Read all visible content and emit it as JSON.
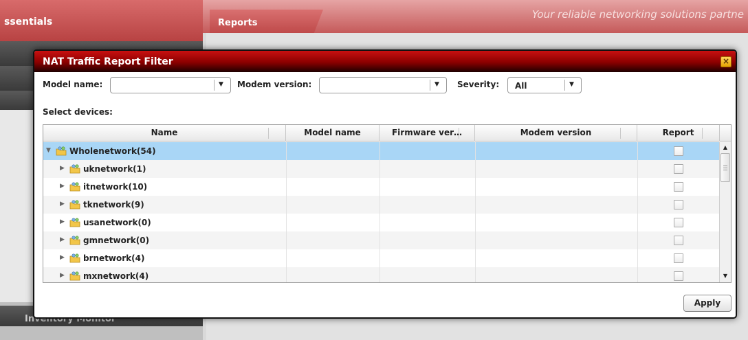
{
  "background": {
    "left_header": "ssentials",
    "tab": "Reports",
    "slogan": "Your reliable networking solutions partne",
    "bottom_item": "Inventory Monitor"
  },
  "dialog": {
    "title": "NAT Traffic Report Filter",
    "close_icon": "close-icon",
    "filters": {
      "model_name_label": "Model name:",
      "model_name_value": "",
      "modem_version_label": "Modem version:",
      "modem_version_value": "",
      "severity_label": "Severity:",
      "severity_value": "All"
    },
    "select_devices_label": "Select devices:",
    "columns": [
      "Name",
      "Model name",
      "Firmware ver…",
      "Modem version",
      "Report"
    ],
    "rows": [
      {
        "name": "Wholenetwork(54)",
        "expanded": true,
        "selected": true,
        "report": false
      },
      {
        "name": "uknetwork(1)",
        "expanded": false,
        "report": false
      },
      {
        "name": "itnetwork(10)",
        "expanded": false,
        "report": false
      },
      {
        "name": "tknetwork(9)",
        "expanded": false,
        "report": false
      },
      {
        "name": "usanetwork(0)",
        "expanded": false,
        "report": false
      },
      {
        "name": "gmnetwork(0)",
        "expanded": false,
        "report": false
      },
      {
        "name": "brnetwork(4)",
        "expanded": false,
        "report": false
      },
      {
        "name": "mxnetwork(4)",
        "expanded": false,
        "report": false
      }
    ],
    "apply_label": "Apply"
  },
  "colors": {
    "titlebar_top": "#c91010",
    "titlebar_bottom": "#1d0000",
    "selected_row": "#a9d6f6"
  }
}
